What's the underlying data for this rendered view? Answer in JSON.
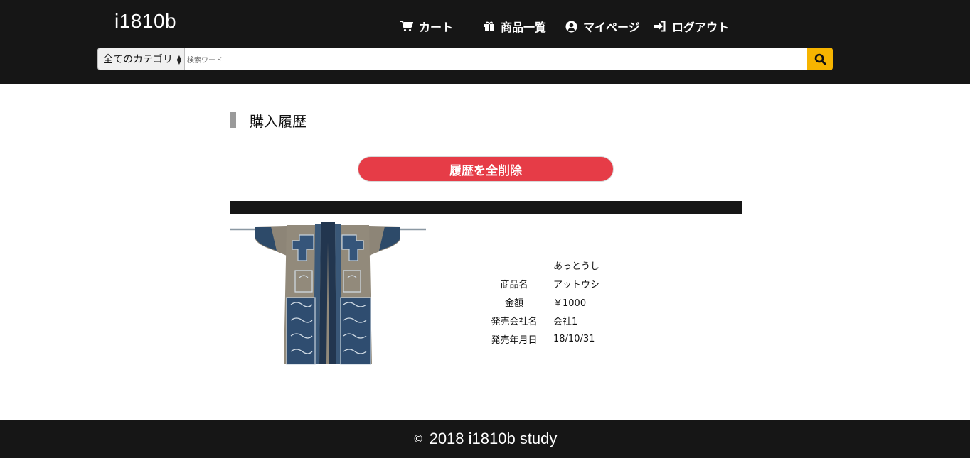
{
  "header": {
    "brand": "i1810b",
    "nav": {
      "cart": "カート",
      "products": "商品一覧",
      "mypage": "マイページ",
      "logout": "ログアウト"
    },
    "search": {
      "category_selected": "全てのカテゴリ",
      "placeholder": "検索ワード"
    }
  },
  "main": {
    "title": "購入履歴",
    "delete_all_label": "履歴を全削除",
    "item": {
      "reading": "あっとうし",
      "fields": [
        {
          "label": "商品名",
          "value": "アットウシ"
        },
        {
          "label": "金額",
          "value": "￥1000"
        },
        {
          "label": "発売会社名",
          "value": "会社1"
        },
        {
          "label": "発売年月日",
          "value": "18/10/31"
        }
      ]
    }
  },
  "footer": {
    "copyright_icon": "©",
    "text": "2018 i1810b study"
  },
  "colors": {
    "header_bg": "#161616",
    "accent_yellow": "#f6b400",
    "delete_red": "#e63c47"
  }
}
